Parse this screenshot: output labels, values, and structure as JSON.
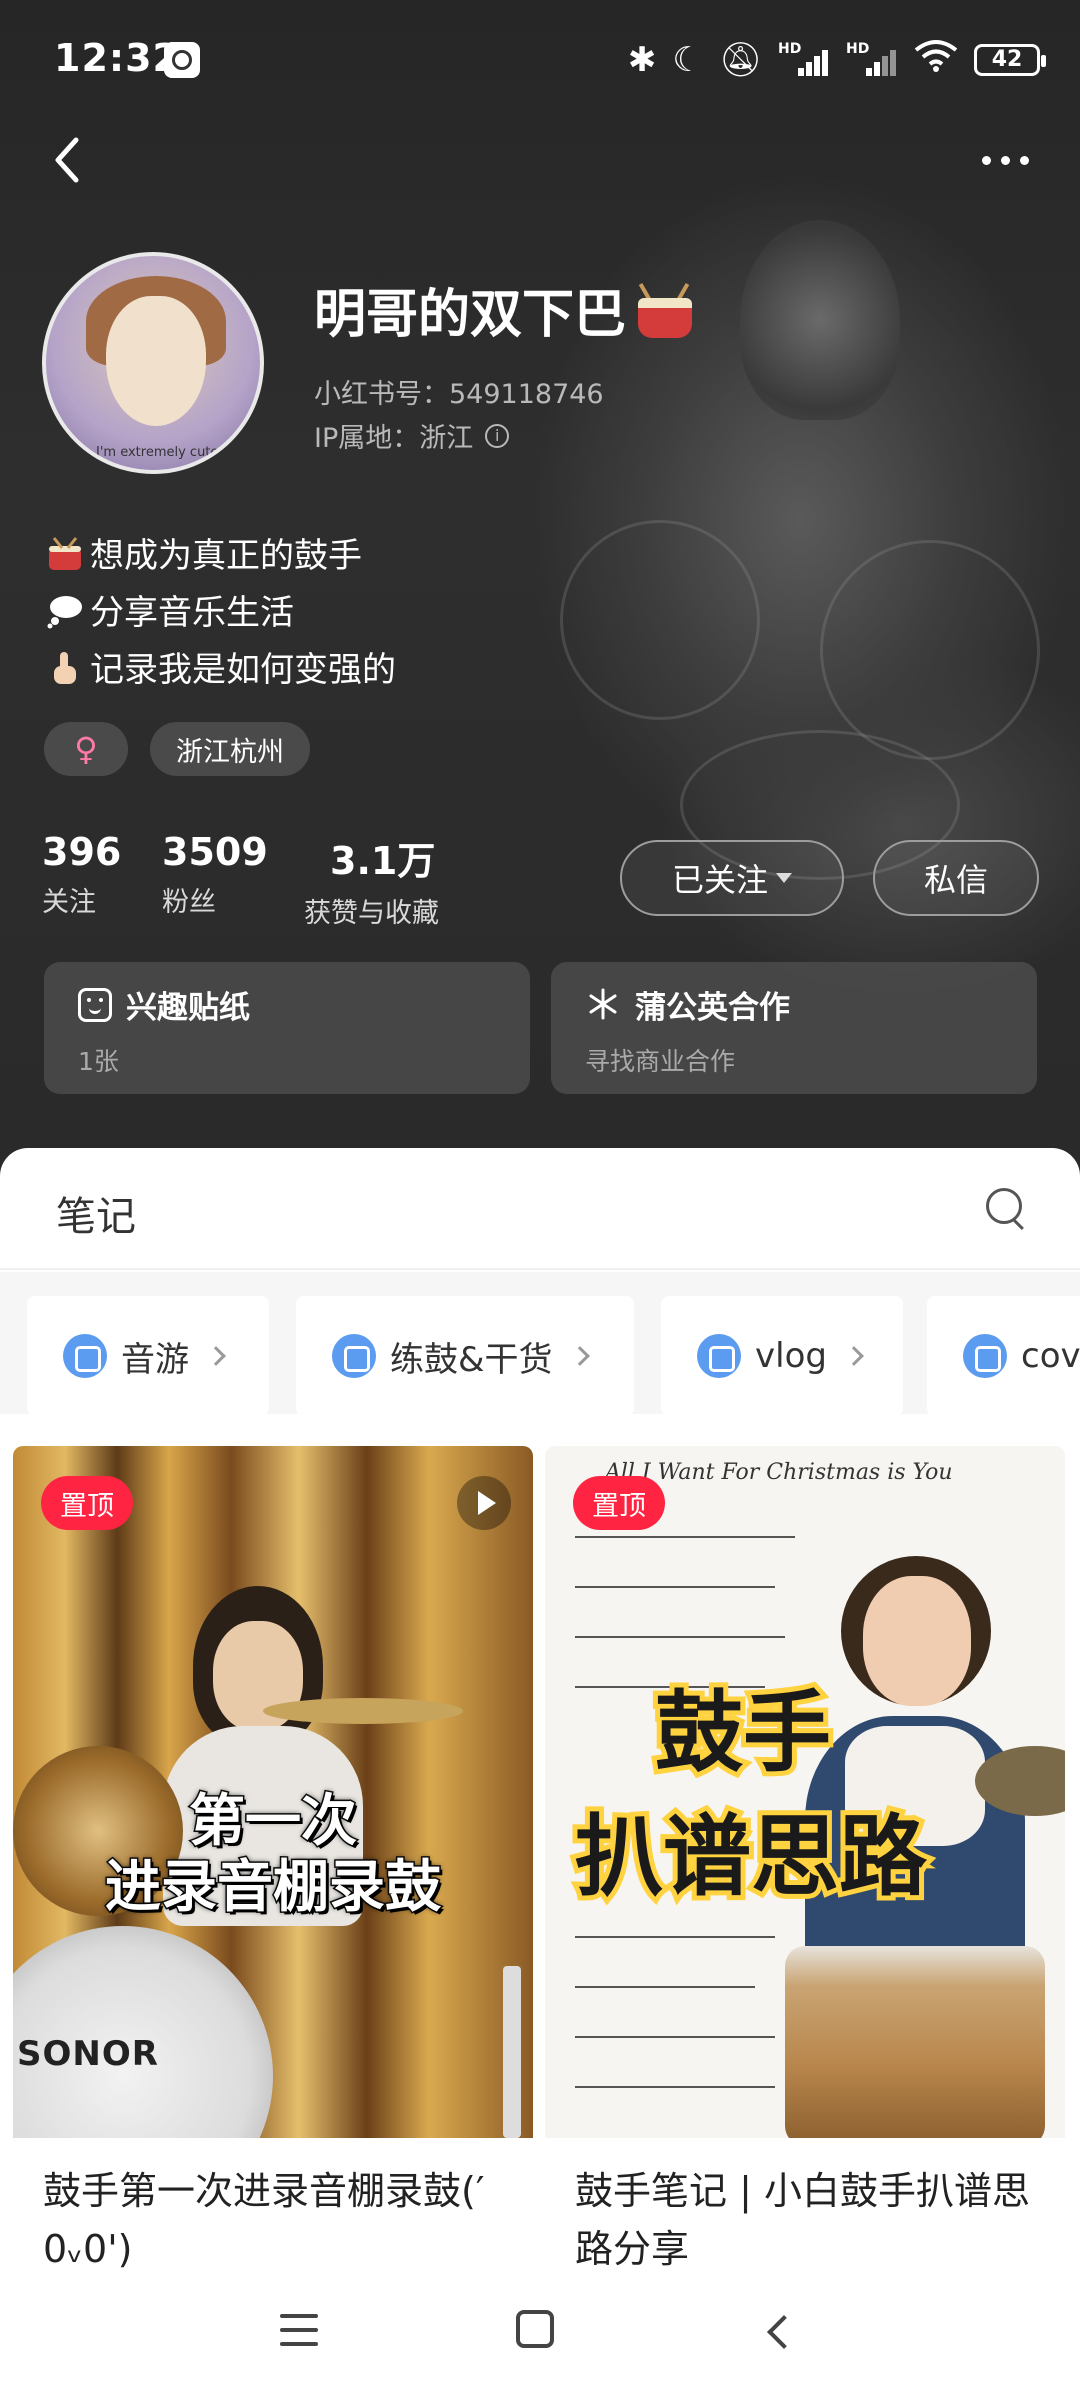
{
  "status_bar": {
    "time": "12:32",
    "battery": "42",
    "icons": [
      "clock-app-icon",
      "bluetooth-icon",
      "moon-icon",
      "mute-bell-icon",
      "hd-signal-icon",
      "hd-signal-icon",
      "wifi-icon",
      "battery-icon"
    ],
    "hd_label": "HD"
  },
  "profile": {
    "nickname": "明哥的双下巴",
    "nickname_emoji": "drum-emoji",
    "red_id": "小红书号：549118746",
    "ip_location": "IP属地：浙江",
    "avatar_caption": "I'm extremely cute",
    "bio": [
      {
        "icon": "drum-icon",
        "text": "想成为真正的鼓手"
      },
      {
        "icon": "thought-bubble-icon",
        "text": "分享音乐生活"
      },
      {
        "icon": "pointing-up-icon",
        "text": "记录我是如何变强的"
      }
    ],
    "tags": {
      "gender": "♀",
      "location": "浙江杭州"
    },
    "stats": [
      {
        "value": "396",
        "label": "关注"
      },
      {
        "value": "3509",
        "label": "粉丝"
      },
      {
        "value": "3.1万",
        "label": "获赞与收藏"
      }
    ],
    "follow_button": "已关注",
    "message_button": "私信",
    "cards": [
      {
        "icon": "sticker-icon",
        "title": "兴趣贴纸",
        "sub": "1张"
      },
      {
        "icon": "dandelion-icon",
        "title": "蒲公英合作",
        "sub": "寻找商业合作"
      }
    ]
  },
  "sheet": {
    "tab": "笔记",
    "collections": [
      {
        "label": "音游"
      },
      {
        "label": "练鼓&干货"
      },
      {
        "label": "vlog"
      },
      {
        "label": "cove"
      }
    ]
  },
  "notes": [
    {
      "pin": "置顶",
      "cover_line1": "第一次",
      "cover_line2": "进录音棚录鼓",
      "cover_brand": "SONOR",
      "title": "鼓手第一次进录音棚录鼓(′ 0ᵥ0')"
    },
    {
      "pin": "置顶",
      "cover_header": "All I Want For Christmas is You",
      "cover_line1": "鼓手",
      "cover_line2": "扒谱思路",
      "title": "鼓手笔记 | 小白鼓手扒谱思路分享"
    }
  ],
  "colors": {
    "accent_red": "#ff2442",
    "chip_blue": "#5b9bf0",
    "hero_dark": "#2a2a2a"
  }
}
